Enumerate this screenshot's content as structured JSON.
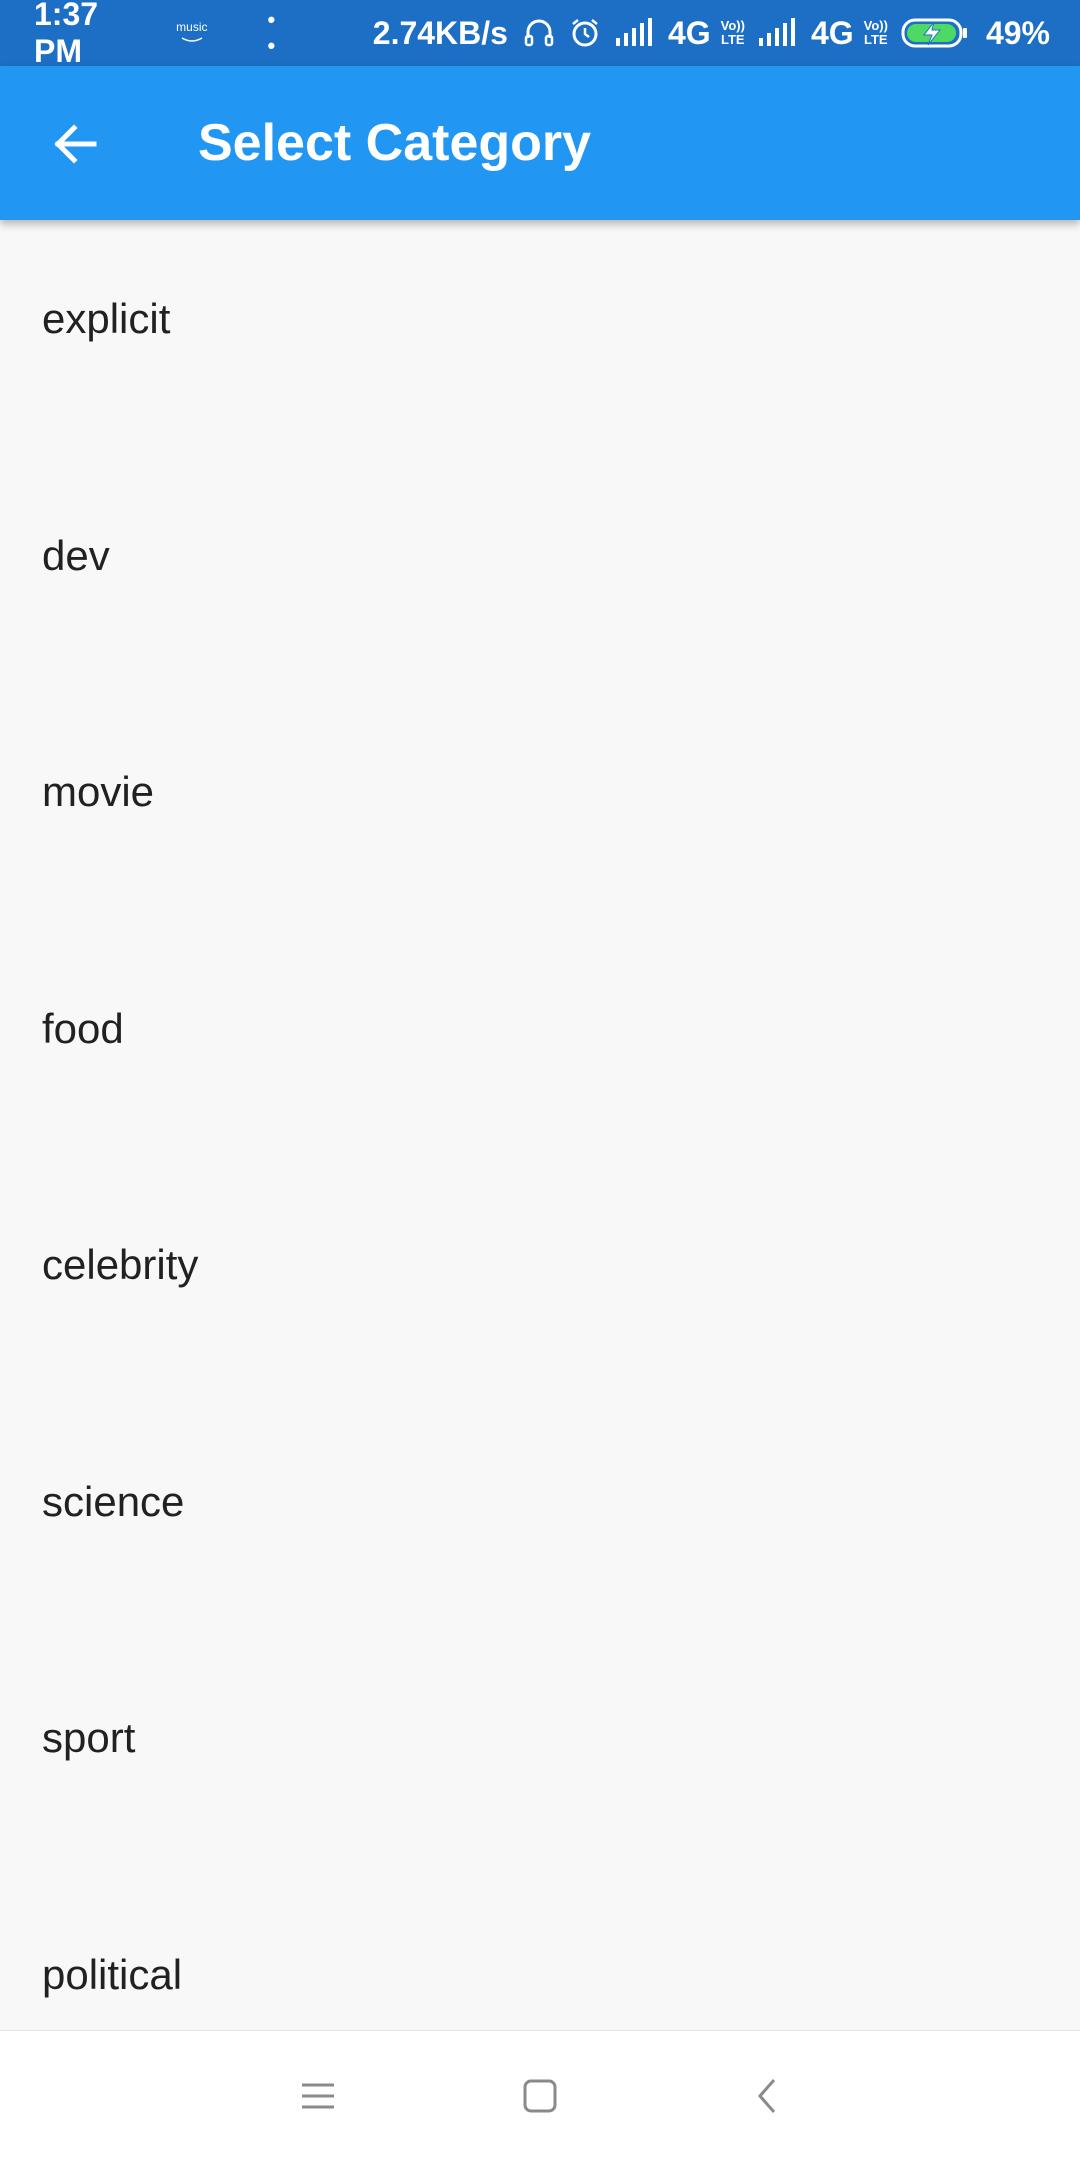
{
  "status_bar": {
    "time": "1:37 PM",
    "music_label": "music",
    "dots": "• •",
    "speed": "2.74KB/s",
    "network1": "4G",
    "volte1_top": "Vo))",
    "volte1_bottom": "LTE",
    "network2": "4G",
    "volte2_top": "Vo))",
    "volte2_bottom": "LTE",
    "battery": "49%",
    "icons": [
      "headphones-icon",
      "alarm-icon",
      "signal-icon",
      "signal-icon",
      "battery-charging-icon"
    ],
    "battery_level": 0.49
  },
  "app_bar": {
    "title": "Select Category",
    "back_icon": "arrow-back-icon"
  },
  "categories": [
    {
      "label": "explicit"
    },
    {
      "label": "dev"
    },
    {
      "label": "movie"
    },
    {
      "label": "food"
    },
    {
      "label": "celebrity"
    },
    {
      "label": "science"
    },
    {
      "label": "sport"
    },
    {
      "label": "political"
    }
  ],
  "nav_bar": {
    "icons": [
      "menu-icon",
      "home-square-icon",
      "back-chevron-icon"
    ]
  },
  "colors": {
    "status_bar": "#1c6fc4",
    "app_bar": "#2196f3",
    "background": "#f8f8f8",
    "text": "#212121",
    "battery_fill": "#4cd964"
  }
}
